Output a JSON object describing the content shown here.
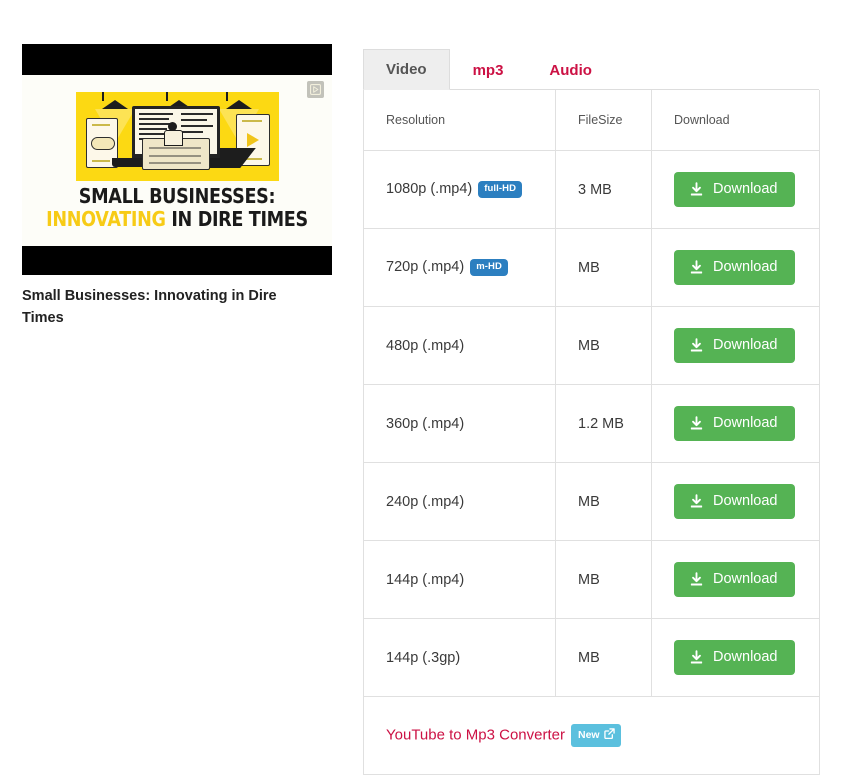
{
  "video": {
    "title": "Small Businesses: Innovating in Dire Times",
    "thumbnail": {
      "headline_line1": "SMALL BUSINESSES:",
      "headline_line2_highlight": "INNOVATING",
      "headline_line2_rest": " IN DIRE TIMES",
      "overlay_icon": "watch-later-icon",
      "highlight_color": "#f7cb16",
      "panel_color": "#fcd913"
    }
  },
  "tabs": [
    {
      "label": "Video",
      "active": true
    },
    {
      "label": "mp3",
      "active": false
    },
    {
      "label": "Audio",
      "active": false
    }
  ],
  "table": {
    "headers": [
      "Resolution",
      "FileSize",
      "Download"
    ],
    "rows": [
      {
        "resolution": "1080p (.mp4)",
        "badge": "full-HD",
        "filesize": "3 MB",
        "download_label": "Download"
      },
      {
        "resolution": "720p (.mp4)",
        "badge": "m-HD",
        "filesize": "MB",
        "download_label": "Download"
      },
      {
        "resolution": "480p (.mp4)",
        "badge": "",
        "filesize": "MB",
        "download_label": "Download"
      },
      {
        "resolution": "360p (.mp4)",
        "badge": "",
        "filesize": "1.2 MB",
        "download_label": "Download"
      },
      {
        "resolution": "240p (.mp4)",
        "badge": "",
        "filesize": "MB",
        "download_label": "Download"
      },
      {
        "resolution": "144p (.mp4)",
        "badge": "",
        "filesize": "MB",
        "download_label": "Download"
      },
      {
        "resolution": "144p (.3gp)",
        "badge": "",
        "filesize": "MB",
        "download_label": "Download"
      }
    ]
  },
  "footer": {
    "link_label": "YouTube to Mp3 Converter",
    "badge_label": "New",
    "badge_icon": "external-link-icon"
  },
  "colors": {
    "accent_red": "#cc1144",
    "download_green": "#55b354",
    "badge_blue": "#2c7fc0",
    "badge_new_blue": "#5bc0de"
  }
}
